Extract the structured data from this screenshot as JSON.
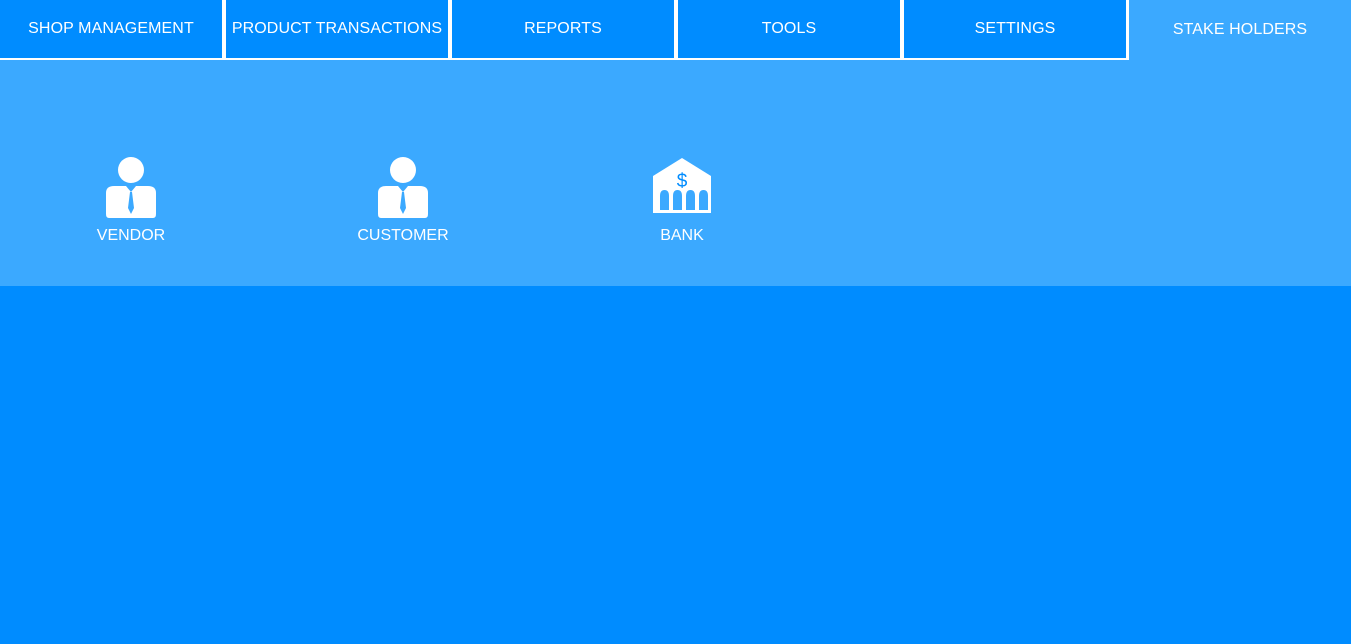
{
  "tabs": [
    {
      "label": "SHOP MANAGEMENT",
      "active": false
    },
    {
      "label": "PRODUCT TRANSACTIONS",
      "active": false
    },
    {
      "label": "REPORTS",
      "active": false
    },
    {
      "label": "TOOLS",
      "active": false
    },
    {
      "label": "SETTINGS",
      "active": false
    },
    {
      "label": "STAKE HOLDERS",
      "active": true
    }
  ],
  "stakeholders": [
    {
      "label": "VENDOR",
      "icon": "person-tie-icon"
    },
    {
      "label": "CUSTOMER",
      "icon": "person-tie-icon"
    },
    {
      "label": "BANK",
      "icon": "bank-icon",
      "icon_symbol": "$"
    }
  ],
  "colors": {
    "primary": "#008cff",
    "active_panel": "#3ba9ff",
    "text": "#ffffff"
  }
}
